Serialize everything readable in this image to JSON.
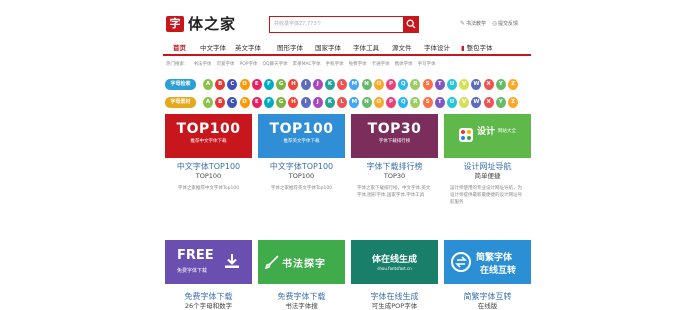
{
  "header": {
    "logo_glyph": "字",
    "logo_text": "体之家",
    "search_placeholder": "共收录字体27,773个",
    "link_tutorial": "书法教学",
    "link_feedback": "提交反馈"
  },
  "nav": {
    "items": [
      "首页",
      "中文字体",
      "英文字体",
      "图形字体",
      "国家字体",
      "字体工具",
      "源文件",
      "字体设计",
      "整包字体"
    ],
    "active_index": 0
  },
  "hot": {
    "label": "热门搜索：",
    "items": [
      "书法字体",
      "可爱字体",
      "POP字体",
      "QQ聊天字体",
      "苹果MAC字体",
      "手机字体",
      "免费字体",
      "卡通字体",
      "楷体字体",
      "手写字体"
    ]
  },
  "alpha_rows": [
    {
      "label": "字母检索",
      "color": "#2c9fd4"
    },
    {
      "label": "字母素材",
      "color": "#e6a91c"
    }
  ],
  "letters": [
    "A",
    "B",
    "C",
    "D",
    "E",
    "F",
    "G",
    "H",
    "I",
    "J",
    "K",
    "L",
    "M",
    "N",
    "O",
    "P",
    "Q",
    "R",
    "S",
    "T",
    "U",
    "V",
    "W",
    "X",
    "Y",
    "Z"
  ],
  "letter_colors": [
    "#8bc34a",
    "#e53935",
    "#3f51b5",
    "#ff9800",
    "#e91e63",
    "#00acc1",
    "#7cb342",
    "#f44336",
    "#5c6bc0",
    "#ab47bc",
    "#26a69a",
    "#ef5350",
    "#42a5f5",
    "#66bb6a",
    "#ffa726",
    "#ec407a",
    "#29b6f6",
    "#9ccc65",
    "#ff7043",
    "#7e57c2",
    "#26c6da",
    "#d4e157",
    "#5c6bc0",
    "#ef5350",
    "#66bb6a",
    "#ffa726"
  ],
  "cards_row1": [
    {
      "big": "TOP100",
      "small": "推荐中文字体下载",
      "bg": "#c8161d",
      "title": "中文字体TOP100",
      "sub": "TOP100",
      "desc": "字体之家推荐中文字体Top100"
    },
    {
      "big": "TOP100",
      "small": "推荐英文字体下载",
      "bg": "#2f8ed6",
      "title": "中文字体TOP100",
      "sub": "TOP100",
      "desc": "字体之家推荐英文字体Top100"
    },
    {
      "big": "TOP30",
      "small": "字体下载排行榜",
      "bg": "#7b2d5c",
      "title": "字体下载排行榜",
      "sub": "TOP30",
      "desc": "字体之家下载排行榜，中文字体,英文字体,图形字体,国家字体,字体工具"
    },
    {
      "big": "设计",
      "small": "网站大全",
      "bg": "#5fb84a",
      "title": "设计网址导航",
      "sub": "简单便捷",
      "desc": "設计师使用的专业设计网址导航，为设计师提供最新最便捷的设计网址导航服务"
    }
  ],
  "cards_row2": [
    {
      "big": "FREE",
      "small": "免费字体下载",
      "bg": "#6a4fb0",
      "title": "免费字体下载",
      "sub": "26个字母和数字"
    },
    {
      "big": "书法探字",
      "small": "",
      "bg": "#3fab4b",
      "title": "免费字体下载",
      "sub": "书法字体搜"
    },
    {
      "big": "体在线生成",
      "small": "shou.fontsfast.cn",
      "bg": "#1a7f6a",
      "title": "字体在线生成",
      "sub": "可生成POP字体"
    },
    {
      "big": "简繁字体",
      "small": "在线互转",
      "bg": "#2a8fd4",
      "title": "简繁字体互转",
      "sub": "在线版"
    }
  ]
}
